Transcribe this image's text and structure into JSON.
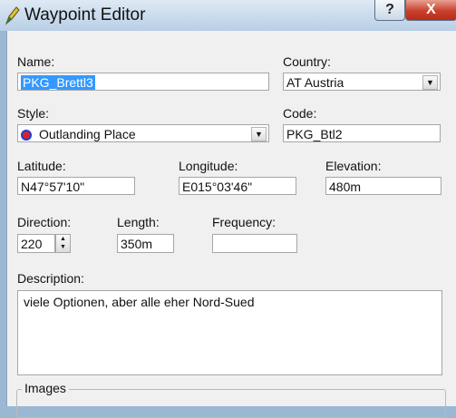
{
  "window": {
    "title": "Waypoint Editor",
    "help_label": "?",
    "close_label": "X"
  },
  "labels": {
    "name": "Name:",
    "country": "Country:",
    "style": "Style:",
    "code": "Code:",
    "latitude": "Latitude:",
    "longitude": "Longitude:",
    "elevation": "Elevation:",
    "direction": "Direction:",
    "length": "Length:",
    "frequency": "Frequency:",
    "description": "Description:",
    "images": "Images"
  },
  "fields": {
    "name": "PKG_Brettl3",
    "country": "AT Austria",
    "style": "Outlanding Place",
    "code": "PKG_Btl2",
    "latitude": "N47°57'10\"",
    "longitude": "E015°03'46\"",
    "elevation": "480m",
    "direction": "220",
    "length": "350m",
    "frequency": "",
    "description": "viele Optionen, aber alle eher Nord-Sued"
  },
  "icons": {
    "app": "pencil-icon",
    "style": "outlanding-place-icon",
    "dropdown": "chevron-down-icon"
  }
}
